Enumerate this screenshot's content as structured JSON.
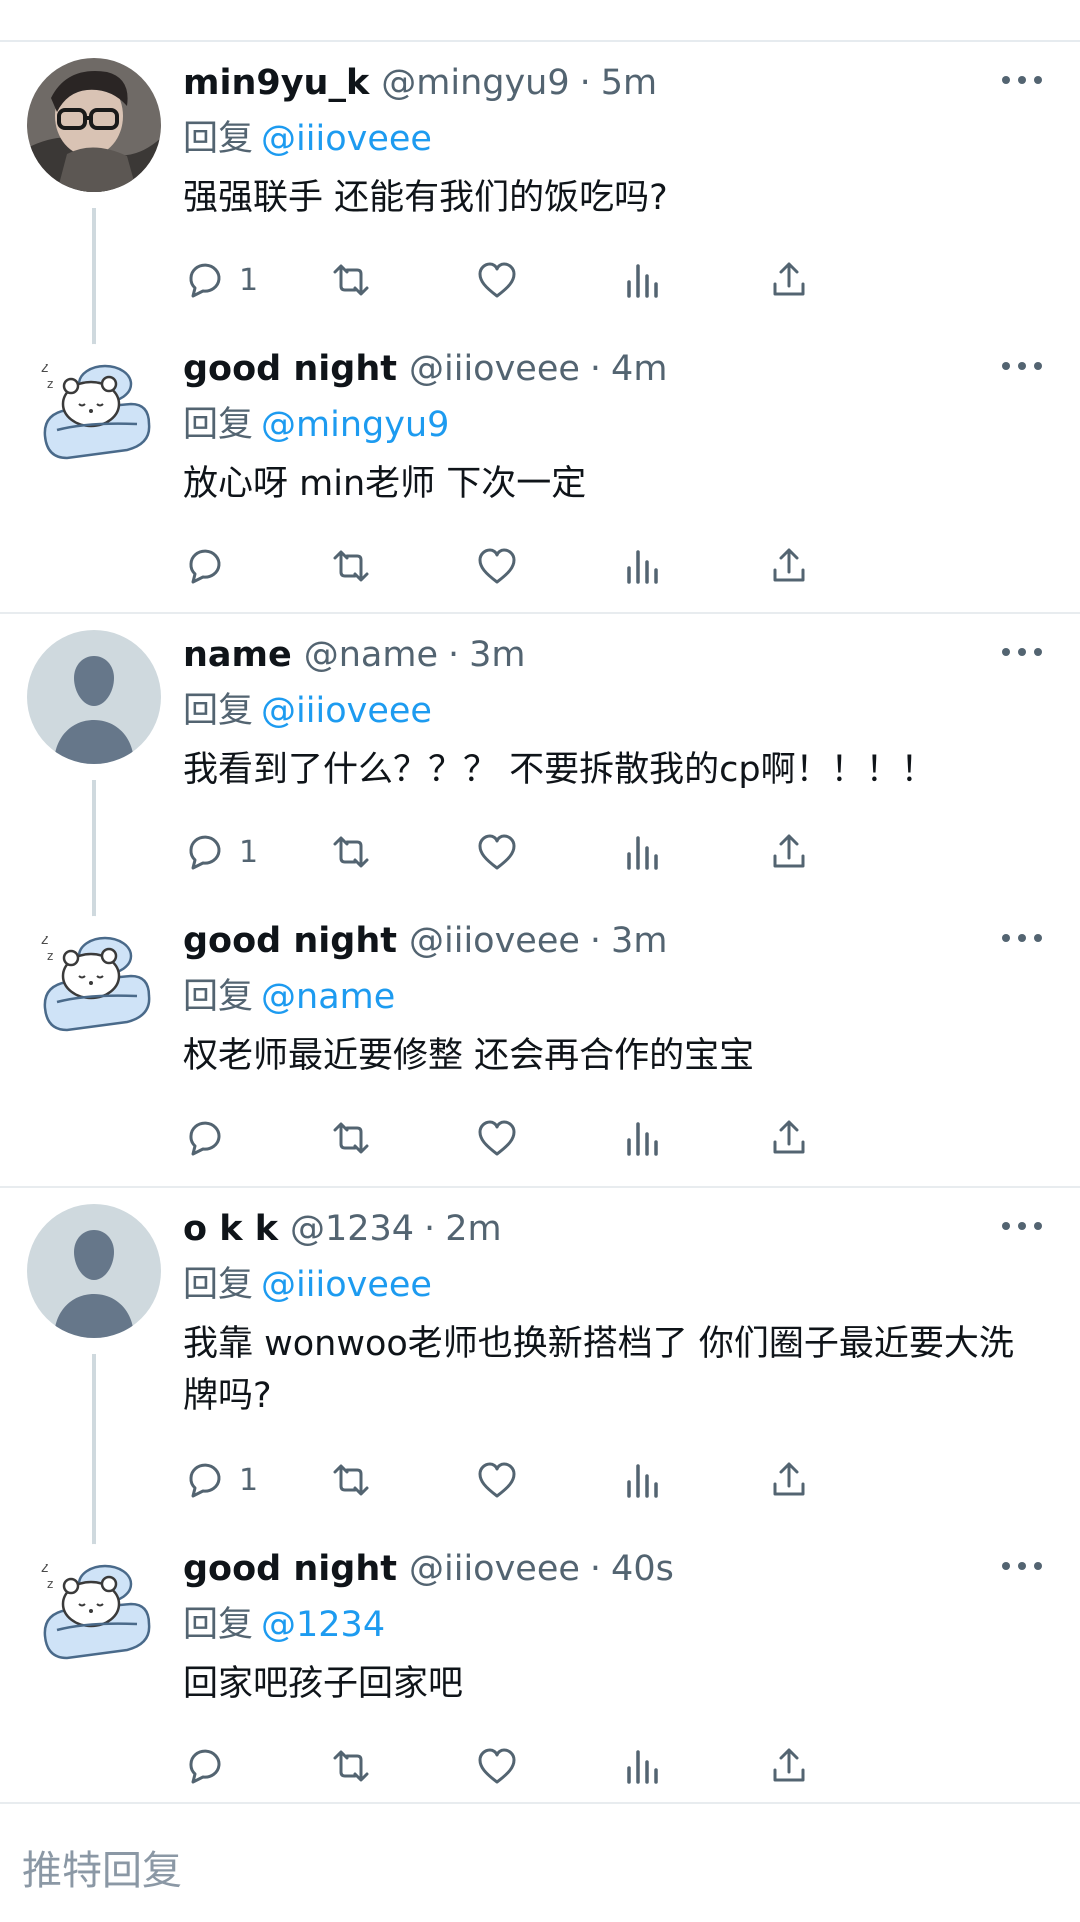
{
  "reply_prefix": "回复",
  "compose": {
    "placeholder": "推特回复"
  },
  "colors": {
    "mention": "#1d9bf0",
    "text": "#0f1419",
    "muted": "#536471",
    "thread_line": "#cfd9de"
  },
  "tweets": [
    {
      "name": "min9yu_k",
      "handle": "@mingyu9",
      "sep": "·",
      "time": "5m",
      "reply_to": "@iiioveee",
      "text": "强强联手 还能有我们的饭吃吗?",
      "reply_count": "1",
      "avatar": "person-photo-avatar"
    },
    {
      "name": "good night",
      "handle": "@iiioveee",
      "sep": "·",
      "time": "4m",
      "reply_to": "@mingyu9",
      "text": "放心呀 min老师 下次一定",
      "reply_count": "",
      "avatar": "sleeping-bear-avatar"
    },
    {
      "name": "name",
      "handle": "@name",
      "sep": "·",
      "time": "3m",
      "reply_to": "@iiioveee",
      "text": "我看到了什么？？？ 不要拆散我的cp啊！！！！",
      "reply_count": "1",
      "avatar": "default-avatar"
    },
    {
      "name": "good night",
      "handle": "@iiioveee",
      "sep": "·",
      "time": "3m",
      "reply_to": "@name",
      "text": "权老师最近要修整 还会再合作的宝宝",
      "reply_count": "",
      "avatar": "sleeping-bear-avatar"
    },
    {
      "name": "o k k",
      "handle": "@1234",
      "sep": "·",
      "time": "2m",
      "reply_to": "@iiioveee",
      "text": "我靠 wonwoo老师也换新搭档了 你们圈子最近要大洗牌吗?",
      "reply_count": "1",
      "avatar": "default-avatar"
    },
    {
      "name": "good night",
      "handle": "@iiioveee",
      "sep": "·",
      "time": "40s",
      "reply_to": "@1234",
      "text": "回家吧孩子回家吧",
      "reply_count": "",
      "avatar": "sleeping-bear-avatar"
    }
  ]
}
